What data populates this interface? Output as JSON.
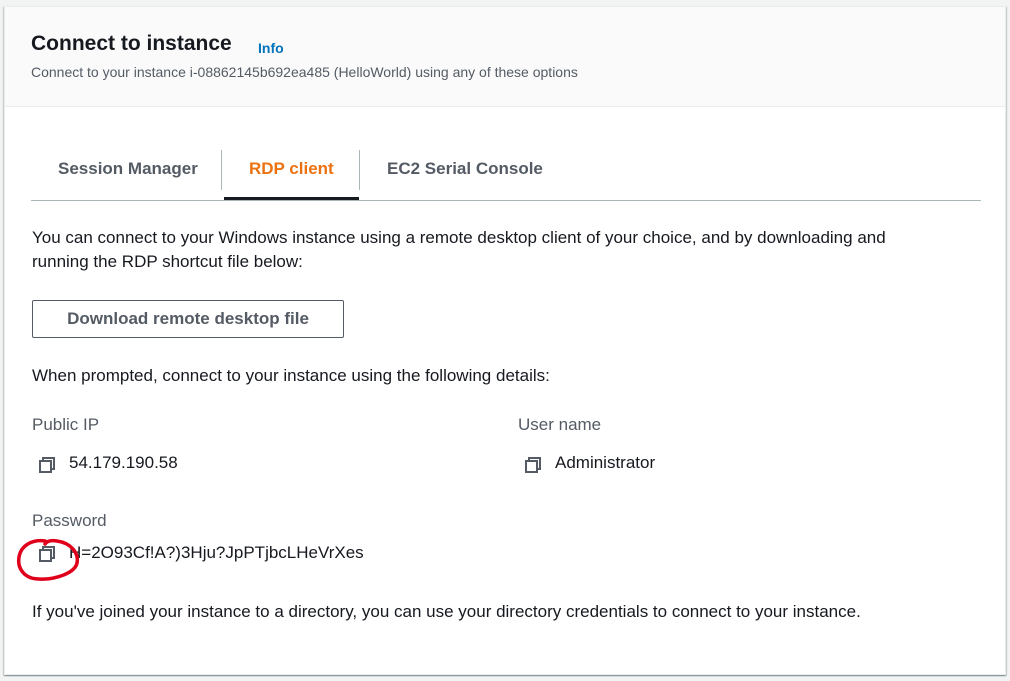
{
  "header": {
    "title": "Connect to instance",
    "info_link": "Info",
    "subtitle": "Connect to your instance i-08862145b692ea485 (HelloWorld) using any of these options"
  },
  "tabs": [
    {
      "label": "Session Manager",
      "active": false
    },
    {
      "label": "RDP client",
      "active": true
    },
    {
      "label": "EC2 Serial Console",
      "active": false
    }
  ],
  "rdp": {
    "intro_line1": "You can connect to your Windows instance using a remote desktop client of your choice, and by downloading and",
    "intro_line2": "running the RDP shortcut file below:",
    "download_button": "Download remote desktop file",
    "prompt_text": "When prompted, connect to your instance using the following details:",
    "public_ip": {
      "label": "Public IP",
      "value": "54.179.190.58",
      "icon": "copy-icon"
    },
    "user_name": {
      "label": "User name",
      "value": "Administrator",
      "icon": "copy-icon"
    },
    "password": {
      "label": "Password",
      "value": "H=2O93Cf!A?)3Hju?JpPTjbcLHeVrXes",
      "icon": "copy-icon"
    },
    "directory_note": "If you've joined your instance to a directory, you can use your directory credentials to connect to your instance."
  },
  "colors": {
    "active_tab": "#ec7211",
    "link": "#0073bb",
    "annotation": "#e0001b"
  }
}
